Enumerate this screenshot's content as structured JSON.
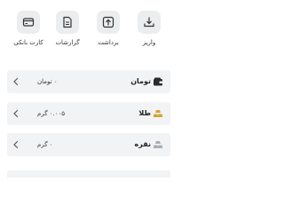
{
  "actions": [
    {
      "label": "کارت بانکی",
      "icon": "card-icon"
    },
    {
      "label": "گزارشات",
      "icon": "report-icon"
    },
    {
      "label": "برداشت",
      "icon": "upload-icon"
    },
    {
      "label": "واریز",
      "icon": "download-icon"
    }
  ],
  "wallet_rows": [
    {
      "name": "تومان",
      "value": "۰ تومان",
      "icon": "wallet-icon"
    },
    {
      "name": "طلا",
      "value": "۰.۰۰۵ گرم",
      "icon": "gold-bars-icon"
    },
    {
      "name": "نقره",
      "value": "۰ گرم",
      "icon": "silver-bars-icon"
    }
  ],
  "colors": {
    "icon_bg": "#ecedef",
    "row_bg": "#f2f3f5",
    "gold": "#d6a52e",
    "silver": "#a9adb3"
  }
}
